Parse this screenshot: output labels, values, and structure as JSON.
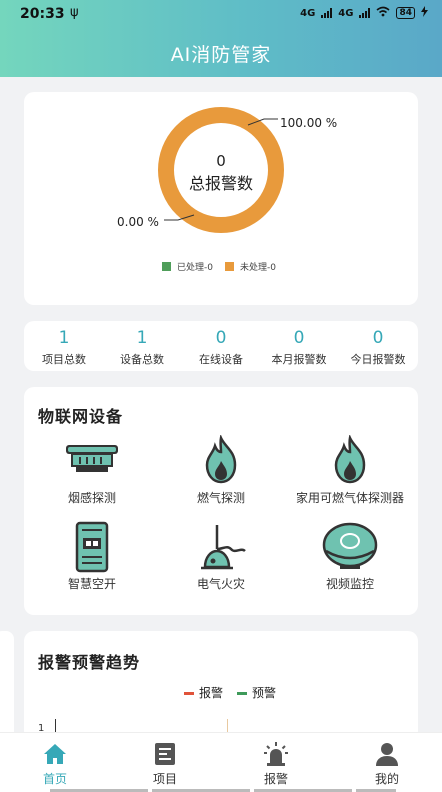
{
  "status_bar": {
    "time": "20:33",
    "extra": "ψ",
    "net1": "4G",
    "net2": "4G",
    "battery": "84"
  },
  "app": {
    "title": "AI消防管家"
  },
  "alarm_summary": {
    "total_value": "0",
    "total_label": "总报警数",
    "pct_unprocessed": "100.00 %",
    "pct_processed": "0.00 %",
    "legend": [
      {
        "label": "已处理-0",
        "color": "#4f9e5a"
      },
      {
        "label": "未处理-0",
        "color": "#e89a3c"
      }
    ]
  },
  "stats": [
    {
      "value": "1",
      "label": "项目总数"
    },
    {
      "value": "1",
      "label": "设备总数"
    },
    {
      "value": "0",
      "label": "在线设备"
    },
    {
      "value": "0",
      "label": "本月报警数"
    },
    {
      "value": "0",
      "label": "今日报警数"
    }
  ],
  "iot": {
    "title": "物联网设备",
    "devices": [
      {
        "label": "烟感探测",
        "icon": "smoke-detector-icon"
      },
      {
        "label": "燃气探测",
        "icon": "gas-flame-icon"
      },
      {
        "label": "家用可燃气体探测器",
        "icon": "home-gas-flame-icon"
      },
      {
        "label": "智慧空开",
        "icon": "smart-breaker-icon"
      },
      {
        "label": "电气火灾",
        "icon": "electrical-fire-icon"
      },
      {
        "label": "视频监控",
        "icon": "camera-icon"
      }
    ]
  },
  "trend": {
    "title": "报警预警趋势",
    "legend": [
      {
        "label": "报警",
        "color": "#e0533a"
      },
      {
        "label": "预警",
        "color": "#3e9a5a"
      }
    ],
    "axis_tick": "1"
  },
  "tabbar": {
    "tabs": [
      {
        "label": "首页",
        "icon": "home-icon",
        "active": true
      },
      {
        "label": "项目",
        "icon": "project-icon",
        "active": false
      },
      {
        "label": "报警",
        "icon": "alarm-icon",
        "active": false
      },
      {
        "label": "我的",
        "icon": "user-icon",
        "active": false
      }
    ]
  },
  "colors": {
    "accent": "#36a8b7",
    "donut": "#e89a3c",
    "icon_fill": "#6fc2b0"
  }
}
